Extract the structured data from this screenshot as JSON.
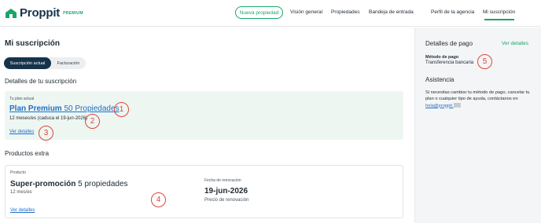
{
  "header": {
    "logo_text": "Proppit",
    "logo_badge": "PREMIUM",
    "nav_button": "Nueva propiedad",
    "nav": {
      "vision": "Visión general",
      "properties": "Propiedades",
      "inbox": "Bandeja de entrada",
      "agency": "Perfil de la agencia",
      "subscription": "Mi suscripción"
    }
  },
  "main": {
    "title": "Mi suscripción",
    "tabs": {
      "current": "Suscripción actual",
      "billing": "Facturación"
    },
    "subscription_section": "Detalles de tu suscripción",
    "plan": {
      "label": "Tu plan actual",
      "name": "Plan Premium",
      "properties": "50 Propiedades",
      "details": "12 meses/es (caduca el 19-jun-2026)",
      "link": "Ver detalles"
    },
    "extras_section": "Productos extra",
    "extra": {
      "label": "Producto",
      "name": "Super-promoción",
      "properties": "5 propiedades",
      "period": "12 mes/es",
      "renewal_label": "Fecha de renovación",
      "renewal_date": "19-jun-2026",
      "renewal_price": "Precio de renovación",
      "link": "Ver detalles"
    }
  },
  "sidebar": {
    "payment_title": "Detalles de pago",
    "payment_link": "Ver detalles",
    "method_label": "Método de pago",
    "method_value": "Transferencia bancaria",
    "help_title": "Asistencia",
    "help_text": "Si necesitas cambiar tu método de pago, cancelar tu plan o cualquier tipo de ayuda, contáctanos en ",
    "help_email": "hola@proppit."
  },
  "markers": [
    "1",
    "2",
    "3",
    "4",
    "5"
  ],
  "colors": {
    "brand_green": "#1aa56b",
    "navy": "#16334a",
    "link_blue": "#1f6fc9",
    "marker_red": "#e0443a"
  }
}
